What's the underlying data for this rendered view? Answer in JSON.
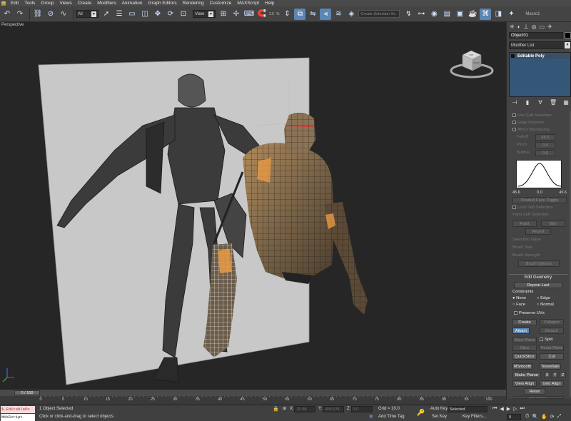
{
  "menu": [
    "Edit",
    "Tools",
    "Group",
    "Views",
    "Create",
    "Modifiers",
    "Animation",
    "Graph Editors",
    "Rendering",
    "Customize",
    "MAXScript",
    "Help"
  ],
  "toolbar": {
    "filter_value": "All",
    "ref_coord_value": "View",
    "snap_label": "2.5",
    "percent_label": "%",
    "named_selection_placeholder": "Create Selection Se",
    "macro_label": "Macro1"
  },
  "viewport": {
    "label": "Perspective",
    "viewcube_front": "FRONT",
    "viewcube_top": "TOP"
  },
  "command_panel": {
    "object_name": "Object01",
    "modifier_list_label": "Modifier List",
    "stack_item": "Editable Poly",
    "soft_selection": {
      "use_soft_selection": "Use Soft Selection",
      "edge_distance": "Edge Distance",
      "affect_backfacing": "Affect Backfacing",
      "falloff_label": "Falloff",
      "falloff_value": "45.6",
      "pinch_label": "Pinch",
      "pinch_value": "0.0",
      "bubble_label": "Bubble",
      "bubble_value": "0.0",
      "curve_left": "45.6",
      "curve_mid": "0.0",
      "curve_right": "45.6",
      "shaded_face_toggle": "Shaded Face Toggle",
      "lock_soft_selection": "Lock Soft Selection",
      "paint_soft_selection": "Paint Soft Selection",
      "paint": "Paint",
      "blur": "Blur",
      "revert": "Revert",
      "selection_value": "Selection Value",
      "brush_size": "Brush Size",
      "brush_strength": "Brush Strength",
      "brush_options": "Brush Options"
    },
    "edit_geometry": {
      "title": "Edit Geometry",
      "repeat_last": "Repeat Last",
      "constraints": "Constraints",
      "none": "None",
      "edge": "Edge",
      "face": "Face",
      "normal": "Normal",
      "preserve_uvs": "Preserve UVs",
      "create": "Create",
      "collapse": "Collapse",
      "attach": "Attach",
      "detach": "Detach",
      "slice_plane": "Slice Plane",
      "split": "Split",
      "slice": "Slice",
      "reset_plane": "Reset Plane",
      "quickslice": "QuickSlice",
      "cut": "Cut",
      "msmooth": "MSmooth",
      "tessellate": "Tessellate",
      "make_planar": "Make Planar",
      "x": "X",
      "y": "Y",
      "z": "Z",
      "view_align": "View Align",
      "grid_align": "Grid Align",
      "relax": "Relax",
      "hide_selected": "Hide Selected"
    }
  },
  "timeline": {
    "frame_display": "0 / 100",
    "ticks": [
      "0",
      "5",
      "10",
      "15",
      "20",
      "25",
      "30",
      "35",
      "40",
      "45",
      "50",
      "55",
      "60",
      "65",
      "70",
      "75",
      "80",
      "85",
      "90",
      "95",
      "100"
    ]
  },
  "status": {
    "maxscript_line": "$.EditablePo",
    "maxscript_prompt": "MAXScript.",
    "selection_status": "1 Object Selected",
    "prompt": "Click or click-and-drag to select objects",
    "x_label": "X:",
    "x_value": "-32.88",
    "y_label": "Y:",
    "y_value": "-456.074",
    "z_label": "Z:",
    "z_value": "0.0",
    "grid": "Grid = 10.0",
    "add_time_tag": "Add Time Tag",
    "auto_key": "Auto Key",
    "set_key": "Set Key",
    "selected_dropdown": "Selected",
    "key_filters": "Key Filters...",
    "current_frame": "0"
  }
}
